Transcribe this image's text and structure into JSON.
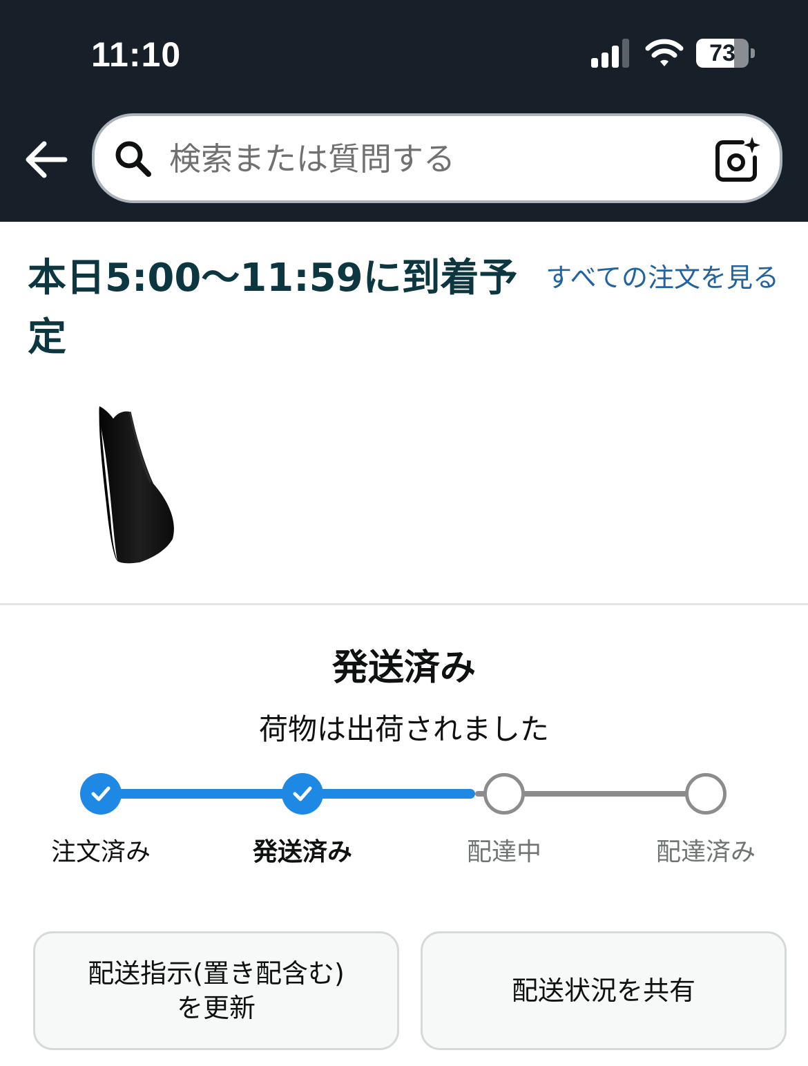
{
  "status_bar": {
    "time": "11:10",
    "battery_level": "73",
    "battery_fraction": 0.73
  },
  "search": {
    "placeholder": "検索または質問する",
    "icons": [
      "back-arrow-icon",
      "search-icon",
      "camera-sparkle-icon"
    ]
  },
  "delivery": {
    "arrival_text": "本日5:00〜11:59に到着予定",
    "all_orders_link": "すべての注文を見る",
    "product_image": "black-lumbar-cushion"
  },
  "status": {
    "title": "発送済み",
    "subtitle": "荷物は出荷されました",
    "current_step": 1,
    "steps": [
      {
        "label": "注文済み",
        "state": "done"
      },
      {
        "label": "発送済み",
        "state": "current"
      },
      {
        "label": "配達中",
        "state": "pending"
      },
      {
        "label": "配達済み",
        "state": "pending"
      }
    ]
  },
  "actions": {
    "update_instructions": "配送指示(置き配含む)\nを更新",
    "share_status": "配送状況を共有"
  },
  "colors": {
    "header_bg": "#172029",
    "progress_blue": "#1e88e5",
    "link_blue": "#2162a1",
    "heading": "#0c3640"
  }
}
